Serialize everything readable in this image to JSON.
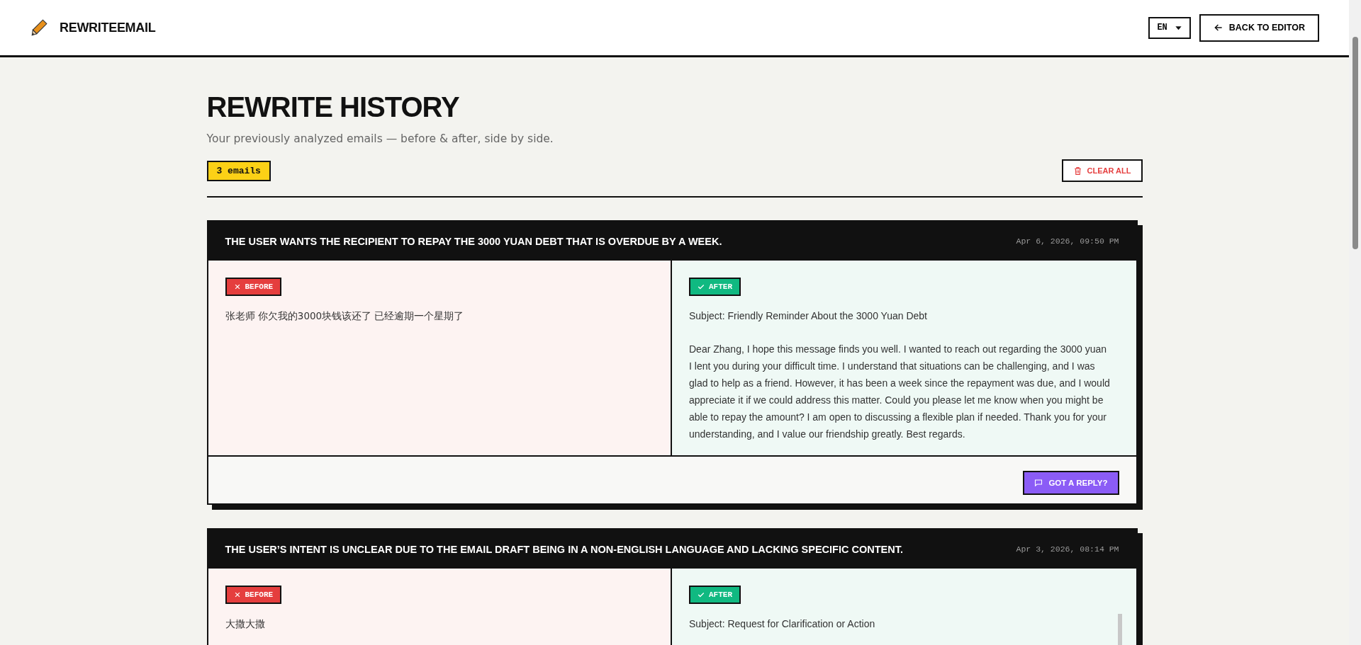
{
  "header": {
    "logo": "REWRITEEMAIL",
    "language": "EN",
    "back_button": "BACK TO EDITOR"
  },
  "page": {
    "title": "REWRITE HISTORY",
    "subtitle": "Your previously analyzed emails — before & after, side by side.",
    "count": "3 emails",
    "clear_button": "CLEAR ALL"
  },
  "entries": [
    {
      "intent": "THE USER WANTS THE RECIPIENT TO REPAY THE 3000 YUAN DEBT THAT IS OVERDUE BY A WEEK.",
      "timestamp": "Apr 6, 2026, 09:50 PM",
      "before_label": "BEFORE",
      "before": "张老师 你欠我的3000块钱该还了 已经逾期一个星期了",
      "after_label": "AFTER",
      "after": [
        "Subject: Friendly Reminder About the 3000 Yuan Debt",
        "Dear Zhang, I hope this message finds you well. I wanted to reach out regarding the 3000 yuan I lent you during your difficult time. I understand that situations can be challenging, and I was glad to help as a friend. However, it has been a week since the repayment was due, and I would appreciate it if we could address this matter. Could you please let me know when you might be able to repay the amount? I am open to discussing a flexible plan if needed. Thank you for your understanding, and I value our friendship greatly. Best regards."
      ],
      "reply_button": "GOT A REPLY?"
    },
    {
      "intent": "THE USER’S INTENT IS UNCLEAR DUE TO THE EMAIL DRAFT BEING IN A NON-ENGLISH LANGUAGE AND LACKING SPECIFIC CONTENT.",
      "timestamp": "Apr 3, 2026, 08:14 PM",
      "before_label": "BEFORE",
      "before": "大撒大撒",
      "after_label": "AFTER",
      "after": [
        "Subject: Request for Clarification or Action"
      ]
    }
  ]
}
